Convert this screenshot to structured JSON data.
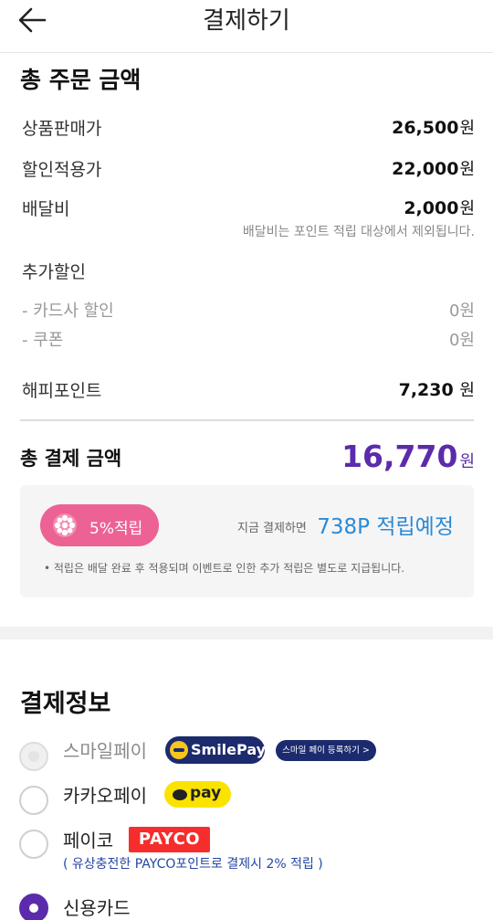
{
  "header": {
    "title": "결제하기",
    "back_icon": "arrow-left-icon"
  },
  "order_summary": {
    "title": "총 주문 금액",
    "rows": [
      {
        "label": "상품판매가",
        "value": "26,500",
        "unit": "원"
      },
      {
        "label": "할인적용가",
        "value": "22,000",
        "unit": "원"
      },
      {
        "label": "배달비",
        "value": "2,000",
        "unit": "원",
        "note": "배달비는 포인트 적립 대상에서 제외됩니다."
      }
    ],
    "extra_discount": {
      "label": "추가할인",
      "items": [
        {
          "label": "- 카드사 할인",
          "value": "0원"
        },
        {
          "label": "- 쿠폰",
          "value": "0원"
        }
      ]
    },
    "points": {
      "label": "해피포인트",
      "value": "7,230",
      "unit": " 원"
    }
  },
  "total": {
    "label": "총 결제 금액",
    "value": "16,770",
    "unit": "원"
  },
  "reward": {
    "badge_label": "5%적립",
    "prefix": "지금 결제하면",
    "amount": "738P 적립예정",
    "note": "• 적립은 배달 완료 후 적용되며 이벤트로 인한 추가 적립은 별도로 지급됩니다."
  },
  "payment_info": {
    "title": "결제정보",
    "methods": [
      {
        "label": "스마일페이",
        "state": "disabled",
        "logo_text": "SmilePay",
        "register_label": "스마일 페이 등록하기 >"
      },
      {
        "label": "카카오페이",
        "state": "unchecked",
        "logo_text": "pay"
      },
      {
        "label": "페이코",
        "state": "unchecked",
        "logo_text": "PAYCO",
        "note": "( 유상충전한 PAYCO포인트로 결제시 2% 적립 )"
      },
      {
        "label": "신용카드",
        "state": "checked"
      }
    ]
  },
  "colors": {
    "accent_purple": "#5b2bab",
    "reward_blue": "#2a8ad6",
    "badge_pink": "#ec6294",
    "smilepay_navy": "#1c2a6e",
    "kakao_yellow": "#fbe300",
    "payco_red": "#f62d2d"
  }
}
